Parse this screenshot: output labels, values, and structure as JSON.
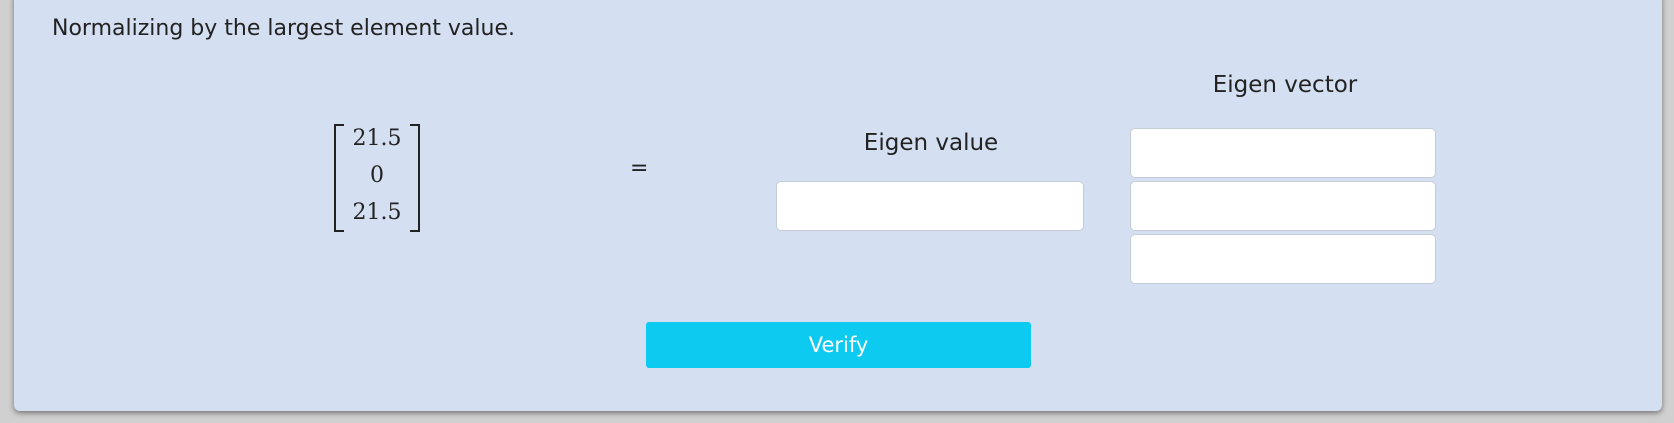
{
  "instruction": "Normalizing by the largest element value.",
  "matrix": {
    "entries": [
      "21.5",
      "0",
      "21.5"
    ]
  },
  "equals_sign": "=",
  "eigen_value": {
    "label": "Eigen value",
    "value": ""
  },
  "eigen_vector": {
    "label": "Eigen vector",
    "values": [
      "",
      "",
      ""
    ]
  },
  "verify_button": {
    "label": "Verify",
    "color": "#0dcaf0"
  },
  "colors": {
    "panel_background": "#d4e0f2",
    "text": "#222222"
  }
}
